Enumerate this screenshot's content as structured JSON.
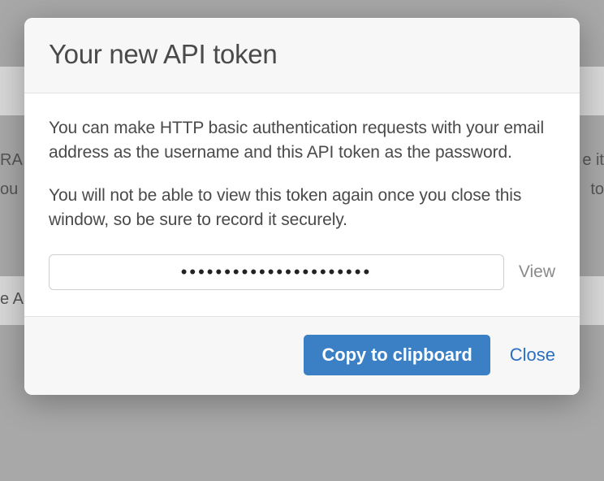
{
  "modal": {
    "title": "Your new API token",
    "paragraph1": "You can make HTTP basic authentication requests with your email address as the username and this API token as the password.",
    "paragraph2": "You will not be able to view this token again once you close this window, so be sure to record it securely.",
    "token_masked": "••••••••••••••••••••••",
    "view_label": "View",
    "copy_label": "Copy to clipboard",
    "close_label": "Close"
  },
  "background": {
    "frag1": "RA",
    "frag2": "ou",
    "frag3": "e A",
    "frag4": "e it",
    "frag5": "to"
  }
}
